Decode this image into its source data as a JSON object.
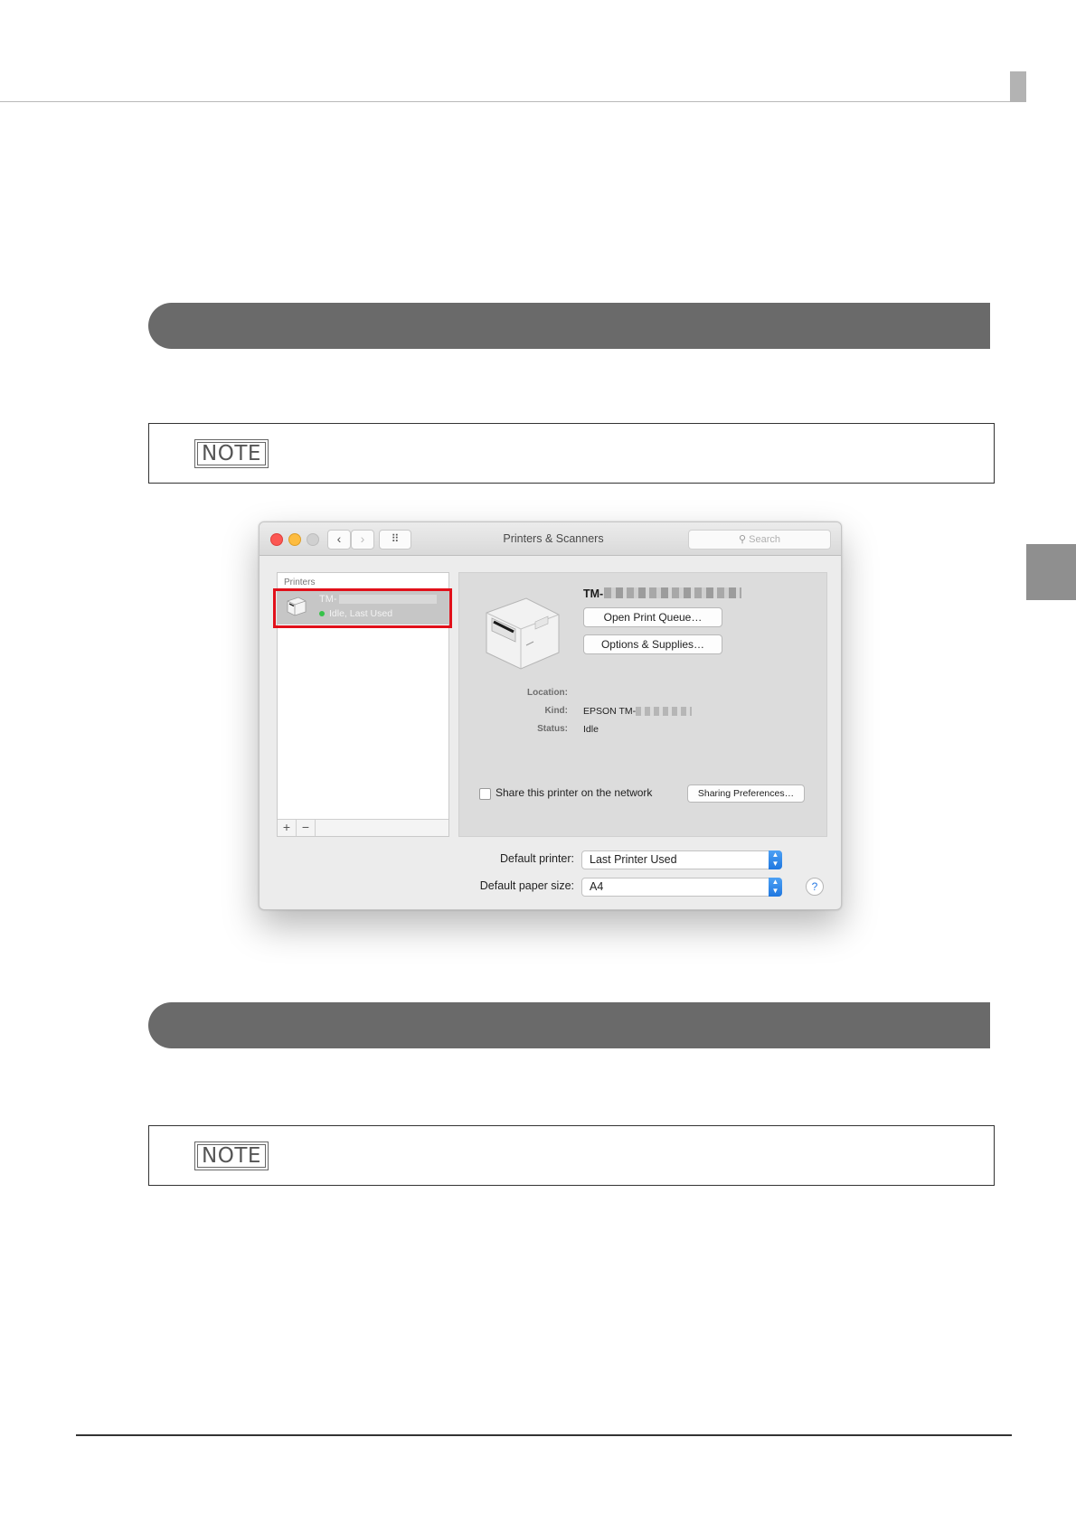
{
  "page": {
    "note_label_1": "NOTE",
    "note_label_2": "NOTE"
  },
  "window": {
    "title": "Printers & Scanners",
    "search_placeholder": "Search",
    "nav_back": "‹",
    "nav_forward": "›",
    "grid_icon": "⠿"
  },
  "printer_list": {
    "header": "Printers",
    "items": [
      {
        "name": "TM-",
        "status": "Idle, Last Used",
        "selected": true
      }
    ],
    "add_label": "+",
    "remove_label": "−"
  },
  "detail": {
    "printer_name": "TM-",
    "open_queue_label": "Open Print Queue…",
    "options_label": "Options & Supplies…",
    "location_label": "Location:",
    "location_value": "",
    "kind_label": "Kind:",
    "kind_value": "EPSON TM-",
    "status_label": "Status:",
    "status_value": "Idle",
    "share_label": "Share this printer on the network",
    "share_checked": false,
    "sharing_prefs_label": "Sharing Preferences…"
  },
  "defaults": {
    "default_printer_label": "Default printer:",
    "default_printer_value": "Last Printer Used",
    "paper_size_label": "Default paper size:",
    "paper_size_value": "A4",
    "help_label": "?"
  },
  "colors": {
    "highlight": "#e1101a",
    "section_bar": "#6a6a6a",
    "close": "#fc5753",
    "minimize": "#fdbc40",
    "zoom": "#d0d0d0",
    "status_dot": "#36c24a"
  }
}
